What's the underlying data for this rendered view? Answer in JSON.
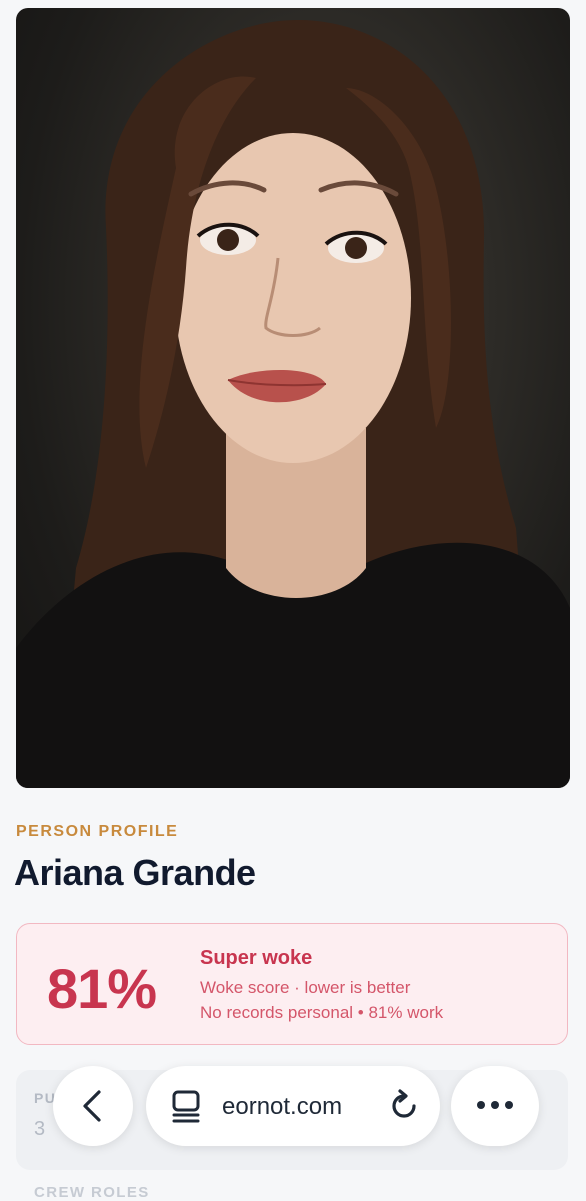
{
  "profile": {
    "section_label": "PERSON PROFILE",
    "name": "Ariana Grande",
    "photo_icon": "portrait-photo"
  },
  "score": {
    "percent": "81%",
    "title": "Super woke",
    "subtitle": "Woke score · lower is better",
    "detail": "No records personal • 81% work",
    "accent_color": "#c8354f",
    "background_color": "#fdeef1"
  },
  "stats": {
    "label": "PU",
    "value": "3"
  },
  "crew": {
    "label": "CREW ROLES"
  },
  "browser_bar": {
    "back_icon": "chevron-left-icon",
    "reader_icon": "reader-mode-icon",
    "url_text": "eornot.com",
    "reload_icon": "reload-icon",
    "more_icon": "more-dots-icon"
  }
}
